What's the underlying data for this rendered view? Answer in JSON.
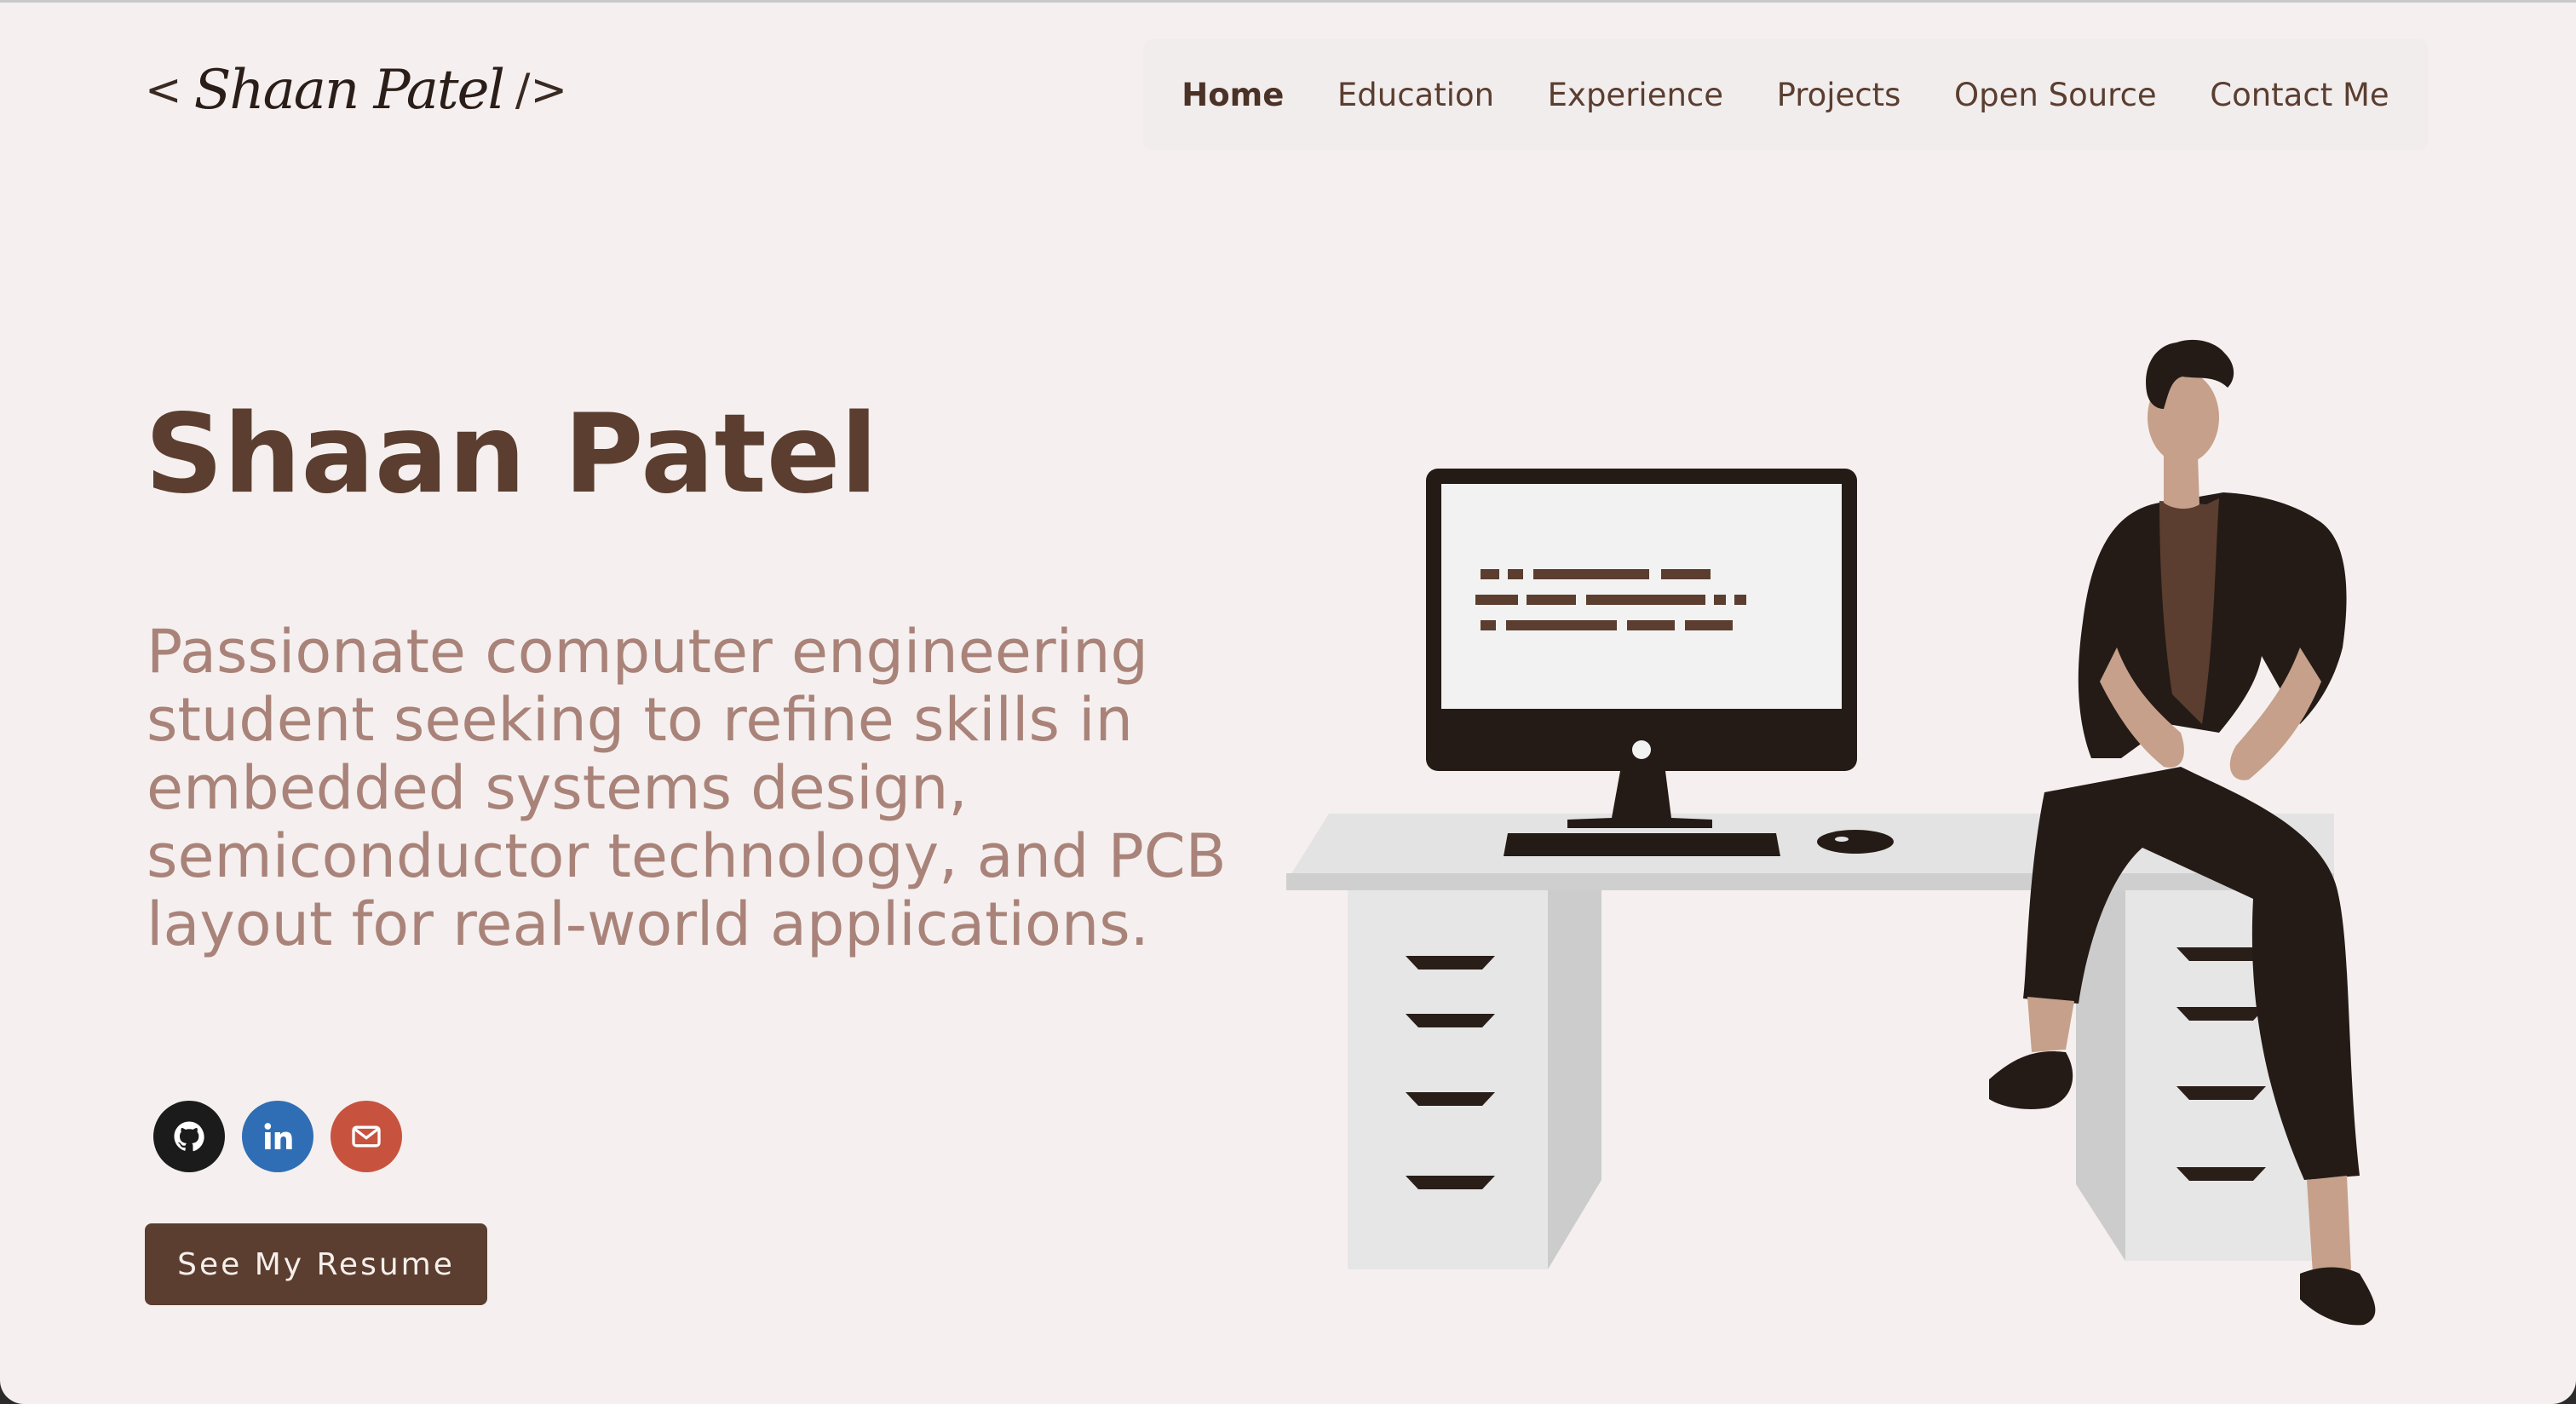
{
  "logo": {
    "open": "<",
    "signature": "Shaan Patel",
    "close": "/>"
  },
  "nav": {
    "items": [
      {
        "label": "Home",
        "active": true
      },
      {
        "label": "Education"
      },
      {
        "label": "Experience"
      },
      {
        "label": "Projects"
      },
      {
        "label": "Open Source"
      },
      {
        "label": "Contact Me"
      }
    ]
  },
  "hero": {
    "name": "Shaan Patel",
    "tagline": "Passionate computer engineering student seeking to refine skills in embedded systems design, semiconductor technology, and PCB layout for real-world applications.",
    "resume_button": "See My Resume"
  },
  "socials": [
    {
      "icon": "github-icon",
      "color": "#1b1b1b"
    },
    {
      "icon": "linkedin-icon",
      "color": "#2f6eb5"
    },
    {
      "icon": "mail-icon",
      "color": "#c7533f"
    }
  ],
  "colors": {
    "background": "#f5f0ef",
    "primary": "#5b3e2f",
    "tagline": "#a98379"
  }
}
